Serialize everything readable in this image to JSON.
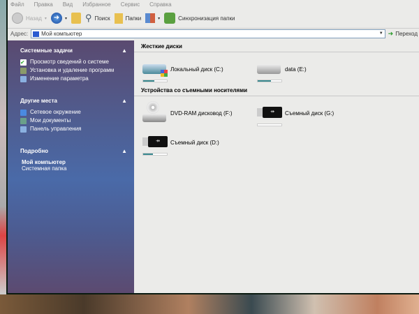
{
  "menu": [
    "Файл",
    "Правка",
    "Вид",
    "Избранное",
    "Сервис",
    "Справка"
  ],
  "toolbar": {
    "back": "Назад",
    "search": "Поиск",
    "folders": "Папки",
    "sync": "Синхронизация папки"
  },
  "address": {
    "label": "Адрес:",
    "value": "Мой компьютер",
    "go": "Переход"
  },
  "sidebar": {
    "system_tasks": {
      "title": "Системные задачи",
      "items": [
        "Просмотр сведений о системе",
        "Установка и удаление программ",
        "Изменение параметра"
      ]
    },
    "other_places": {
      "title": "Другие места",
      "items": [
        "Сетевое окружение",
        "Мои документы",
        "Панель управления"
      ]
    },
    "details": {
      "title": "Подробно",
      "name": "Мой компьютер",
      "type": "Системная папка"
    }
  },
  "hard_disks": {
    "title": "Жесткие диски",
    "drives": [
      {
        "label": "Локальный диск (C:)",
        "used": 0.48
      },
      {
        "label": "data (E:)",
        "used": 0.55
      }
    ]
  },
  "removable": {
    "title": "Устройства со съемными носителями",
    "drives": [
      {
        "label": "DVD-RAM дисковод (F:)"
      },
      {
        "label": "Съемный диск (G:)",
        "used": 0
      },
      {
        "label": "Съемный диск (D:)",
        "used": 0.4
      }
    ]
  }
}
